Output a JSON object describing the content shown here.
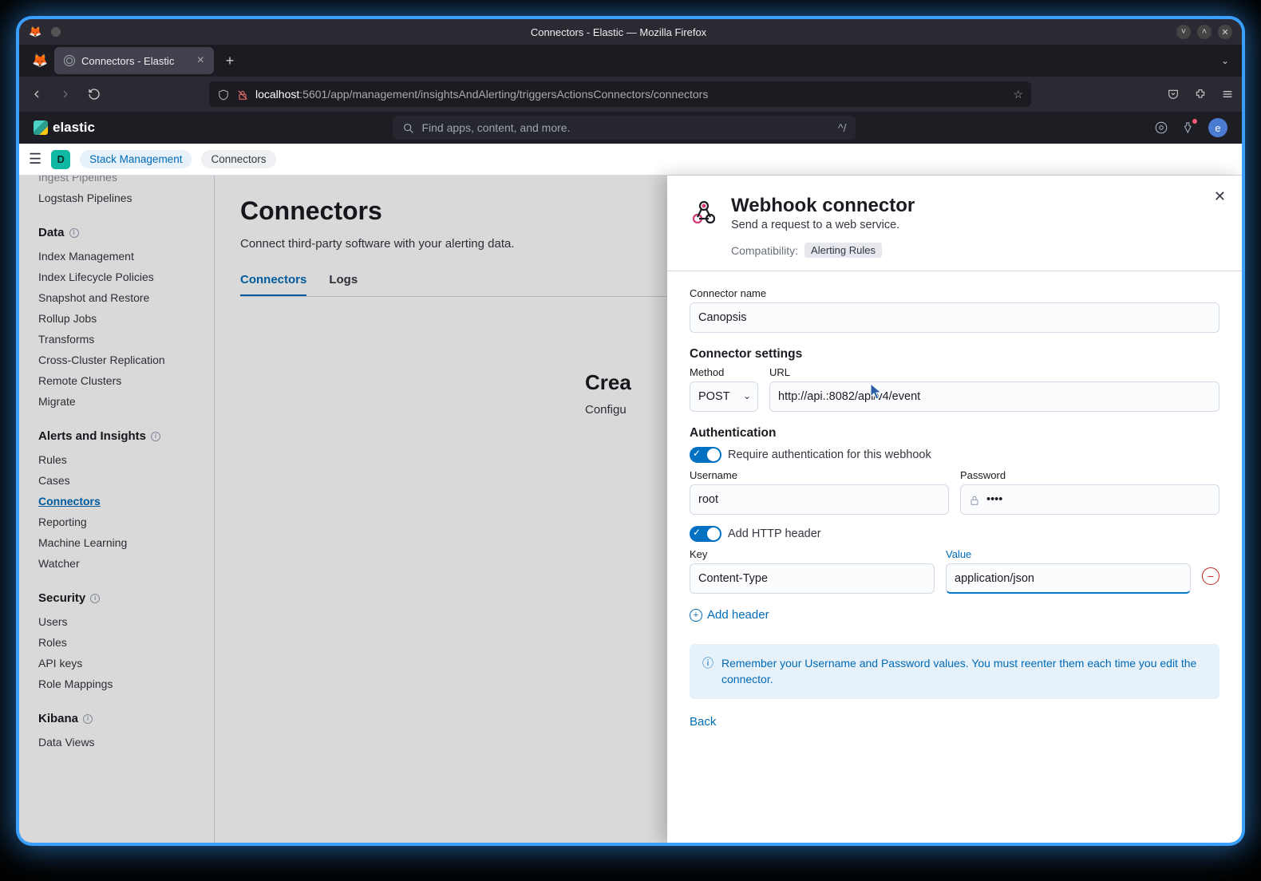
{
  "window": {
    "title": "Connectors - Elastic — Mozilla Firefox",
    "tab_label": "Connectors - Elastic"
  },
  "url": {
    "host": "localhost",
    "path": ":5601/app/management/insightsAndAlerting/triggersActionsConnectors/connectors"
  },
  "header": {
    "brand": "elastic",
    "search_placeholder": "Find apps, content, and more.",
    "shortcut": "^/",
    "avatar_letter": "e",
    "space_letter": "D"
  },
  "breadcrumbs": {
    "link": "Stack Management",
    "current": "Connectors"
  },
  "sidebar": {
    "top_rem1": "Ingest Pipelines",
    "top_rem2": "Logstash Pipelines",
    "sec_data": "Data",
    "data_items": [
      "Index Management",
      "Index Lifecycle Policies",
      "Snapshot and Restore",
      "Rollup Jobs",
      "Transforms",
      "Cross-Cluster Replication",
      "Remote Clusters",
      "Migrate"
    ],
    "sec_alerts": "Alerts and Insights",
    "alerts_items": [
      "Rules",
      "Cases",
      "Connectors",
      "Reporting",
      "Machine Learning",
      "Watcher"
    ],
    "active_index": 2,
    "sec_security": "Security",
    "security_items": [
      "Users",
      "Roles",
      "API keys",
      "Role Mappings"
    ],
    "sec_kibana": "Kibana",
    "kibana_items": [
      "Data Views"
    ]
  },
  "main": {
    "title": "Connectors",
    "subtitle": "Connect third-party software with your alerting data.",
    "tabs": {
      "connectors": "Connectors",
      "logs": "Logs"
    },
    "empty": {
      "title": "Crea",
      "desc": "Configu"
    }
  },
  "flyout": {
    "title": "Webhook connector",
    "desc": "Send a request to a web service.",
    "compat_label": "Compatibility:",
    "compat_badge": "Alerting Rules",
    "name_label": "Connector name",
    "name_value": "Canopsis",
    "settings_label": "Connector settings",
    "method_label": "Method",
    "method_value": "POST",
    "url_label": "URL",
    "url_value": "http://api.:8082/api/v4/event",
    "auth_label": "Authentication",
    "auth_switch_text": "Require authentication for this webhook",
    "username_label": "Username",
    "username_value": "root",
    "password_label": "Password",
    "password_value": "••••",
    "header_switch_text": "Add HTTP header",
    "key_label": "Key",
    "key_value": "Content-Type",
    "value_label": "Value",
    "value_value": "application/json",
    "add_header": "Add header",
    "info_text": "Remember your Username and Password values. You must reenter them each time you edit the connector.",
    "back": "Back"
  }
}
